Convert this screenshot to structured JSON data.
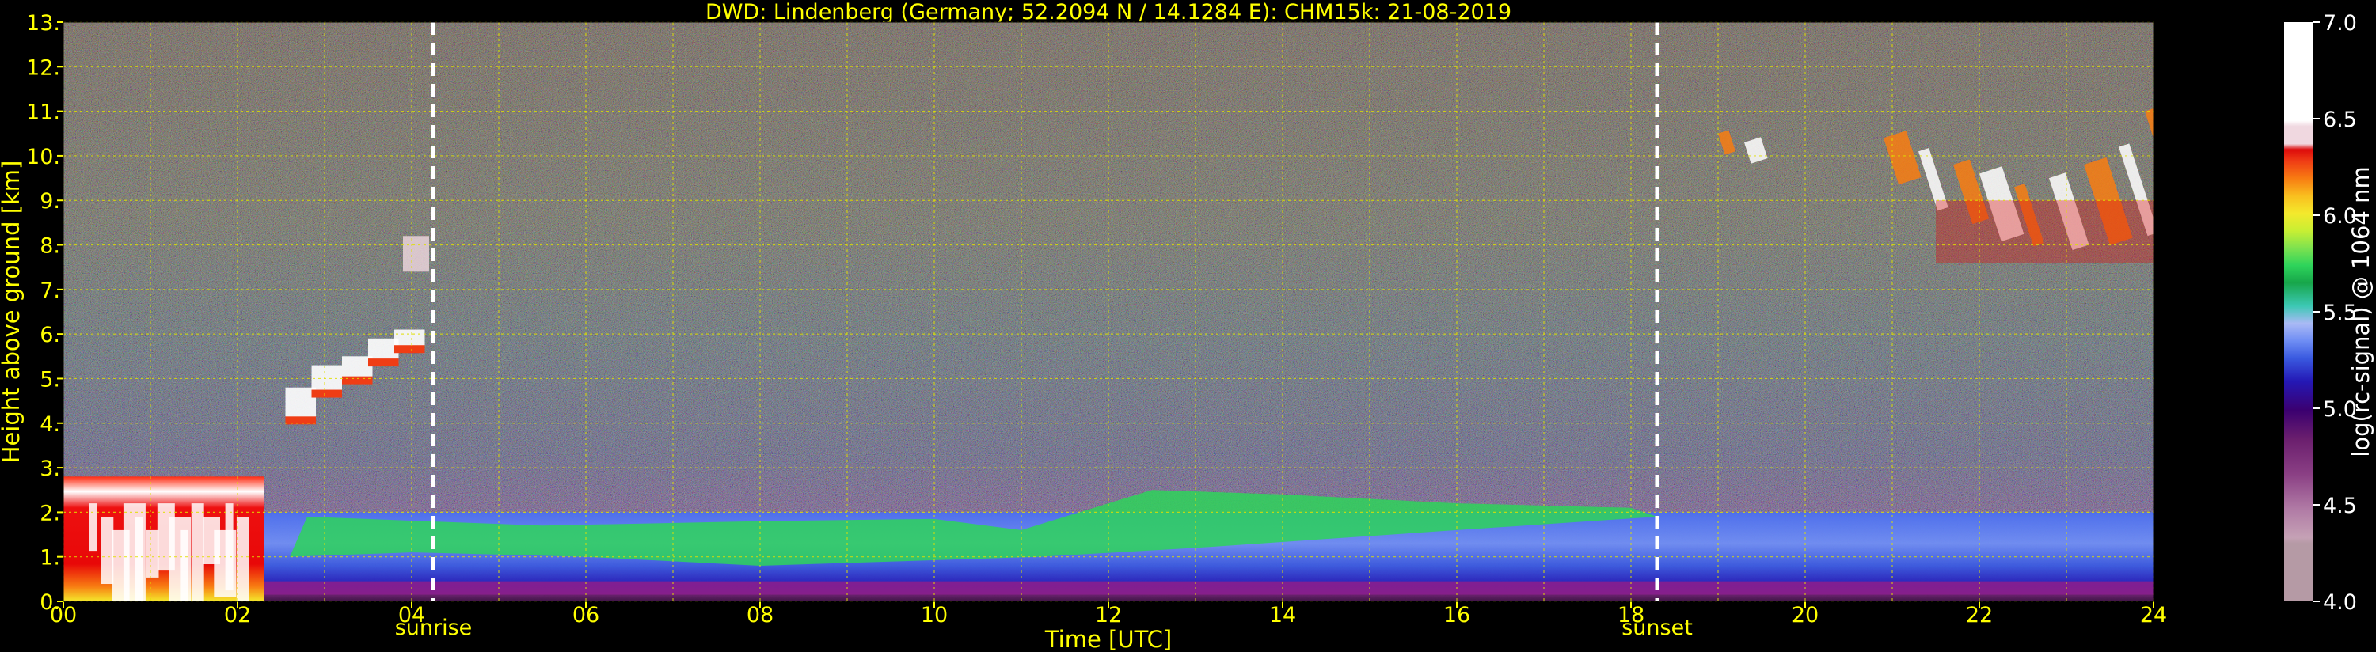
{
  "chart_data": {
    "type": "heatmap",
    "title": "DWD: Lindenberg (Germany; 52.2094 N / 14.1284 E):    CHM15k: 21-08-2019",
    "xlabel": "Time [UTC]",
    "ylabel": "Height above ground [km]",
    "xlim": [
      0,
      24
    ],
    "ylim": [
      0,
      13
    ],
    "x_ticks": [
      "00",
      "02",
      "04",
      "06",
      "08",
      "10",
      "12",
      "14",
      "16",
      "18",
      "20",
      "22",
      "24"
    ],
    "y_ticks": [
      "0.",
      "1.",
      "2.",
      "3.",
      "4.",
      "5.",
      "6.",
      "7.",
      "8.",
      "9.",
      "10.",
      "11.",
      "12.",
      "13."
    ],
    "grid": true,
    "markers": [
      {
        "label": "sunrise",
        "time": 4.25
      },
      {
        "label": "sunset",
        "time": 18.3
      }
    ],
    "colorbar": {
      "label": "log(rc-signal) @ 1064 nm",
      "range": [
        4.0,
        7.0
      ],
      "ticks": [
        "4.0",
        "4.5",
        "5.0",
        "5.5",
        "6.0",
        "6.5",
        "7.0"
      ],
      "colors": [
        "#b59aa5",
        "#c5a1b5",
        "#b07aa5",
        "#8a3f84",
        "#6b1f6e",
        "#3b0070",
        "#2418b5",
        "#3a5ae0",
        "#6f8ef4",
        "#aabaf5",
        "#3cc8b4",
        "#17a64a",
        "#2ed45b",
        "#7ee24f",
        "#c8ef33",
        "#f4e92c",
        "#f9bf1f",
        "#f87c12",
        "#ef3d15",
        "#dd0b0b",
        "#f0d8e0",
        "#ffffff"
      ]
    },
    "features": [
      {
        "name": "boundary layer aerosol",
        "t_start": 0,
        "t_end": 24,
        "h_top": 2.0
      },
      {
        "name": "low cloud",
        "t_start": 0,
        "t_end": 2.3,
        "h_top": 2.8
      },
      {
        "name": "elevated cloud",
        "t_start": 2.5,
        "t_end": 4.2,
        "h_bottom": 3.8,
        "h_top": 6.1
      },
      {
        "name": "cloud",
        "t_start": 3.9,
        "t_end": 4.2,
        "h_bottom": 7.4,
        "h_top": 8.2
      },
      {
        "name": "cirrus",
        "t_start": 19.0,
        "t_end": 24.0,
        "h_bottom": 7.6,
        "h_top": 11.0
      }
    ]
  }
}
